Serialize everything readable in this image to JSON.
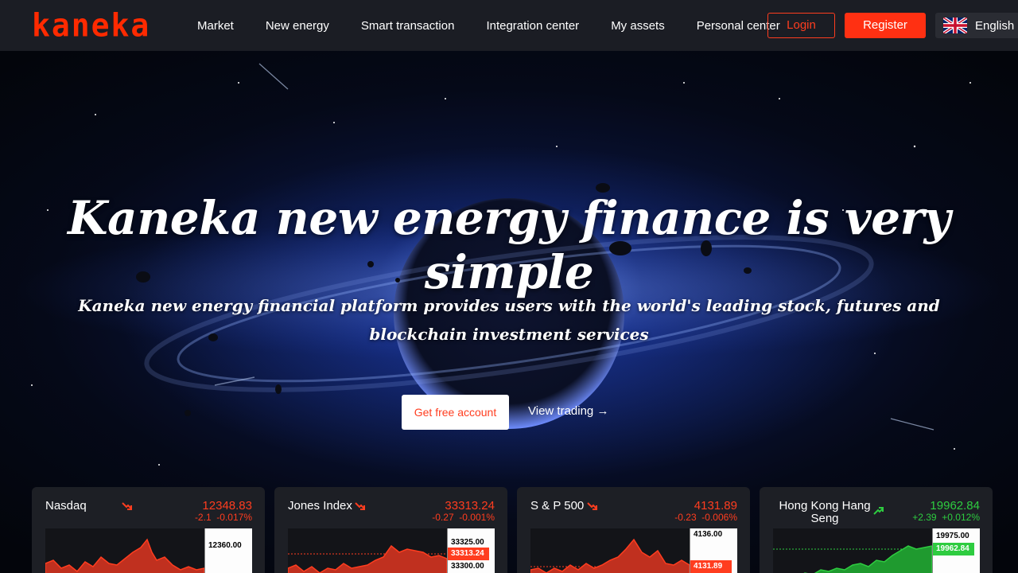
{
  "brand": {
    "logo": "kaneka",
    "accent": "#ff3012"
  },
  "nav": [
    "Market",
    "New energy",
    "Smart transaction",
    "Integration center",
    "My assets",
    "Personal center"
  ],
  "auth": {
    "login": "Login",
    "register": "Register"
  },
  "language": {
    "label": "English",
    "flag": "uk-flag-icon"
  },
  "hero": {
    "title": "Kaneka new energy finance is very simple",
    "subtitle": "Kaneka new energy financial platform provides users with the world's leading stock, futures and blockchain investment services",
    "cta_primary": "Get free account",
    "cta_secondary": "View trading →"
  },
  "markets": [
    {
      "name": "Nasdaq",
      "price": "12348.83",
      "change": "-2.1",
      "change_pct": "-0.017%",
      "direction": "down",
      "axis_top": "12360.00",
      "axis_tag": "",
      "axis_bottom": ""
    },
    {
      "name": "Jones Index",
      "price": "33313.24",
      "change": "-0.27",
      "change_pct": "-0.001%",
      "direction": "down",
      "axis_top": "33325.00",
      "axis_tag": "33313.24",
      "axis_bottom": "33300.00"
    },
    {
      "name": "S & P 500",
      "price": "4131.89",
      "change": "-0.23",
      "change_pct": "-0.006%",
      "direction": "down",
      "axis_top": "4136.00",
      "axis_tag": "4131.89",
      "axis_bottom": ""
    },
    {
      "name": "Hong Kong Hang Seng",
      "price": "19962.84",
      "change": "+2.39",
      "change_pct": "+0.012%",
      "direction": "up",
      "axis_top": "19975.00",
      "axis_tag": "19962.84",
      "axis_bottom": ""
    }
  ]
}
